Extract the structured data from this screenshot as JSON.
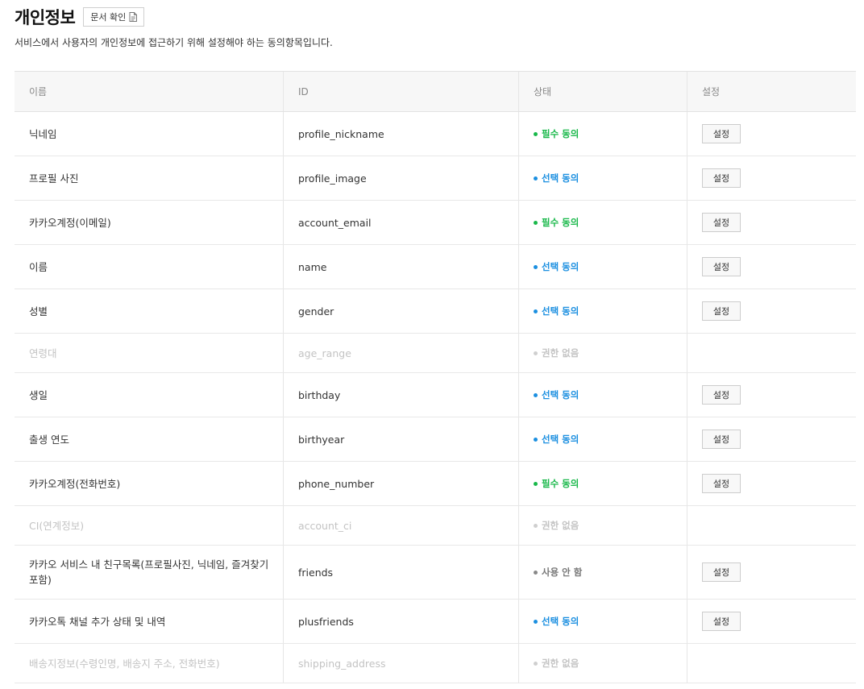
{
  "header": {
    "title": "개인정보",
    "doc_button_label": "문서 확인",
    "description": "서비스에서 사용자의 개인정보에 접근하기 위해 설정해야 하는 동의항목입니다."
  },
  "table": {
    "columns": [
      "이름",
      "ID",
      "상태",
      "설정"
    ],
    "rows": [
      {
        "name": "닉네임",
        "id": "profile_nickname",
        "status": "필수 동의",
        "status_type": "required",
        "button": "설정"
      },
      {
        "name": "프로필 사진",
        "id": "profile_image",
        "status": "선택 동의",
        "status_type": "optional",
        "button": "설정"
      },
      {
        "name": "카카오계정(이메일)",
        "id": "account_email",
        "status": "필수 동의",
        "status_type": "required",
        "button": "설정"
      },
      {
        "name": "이름",
        "id": "name",
        "status": "선택 동의",
        "status_type": "optional",
        "button": "설정"
      },
      {
        "name": "성별",
        "id": "gender",
        "status": "선택 동의",
        "status_type": "optional",
        "button": "설정"
      },
      {
        "name": "연령대",
        "id": "age_range",
        "status": "권한 없음",
        "status_type": "none",
        "button": ""
      },
      {
        "name": "생일",
        "id": "birthday",
        "status": "선택 동의",
        "status_type": "optional",
        "button": "설정"
      },
      {
        "name": "출생 연도",
        "id": "birthyear",
        "status": "선택 동의",
        "status_type": "optional",
        "button": "설정"
      },
      {
        "name": "카카오계정(전화번호)",
        "id": "phone_number",
        "status": "필수 동의",
        "status_type": "required",
        "button": "설정"
      },
      {
        "name": "CI(연계정보)",
        "id": "account_ci",
        "status": "권한 없음",
        "status_type": "none",
        "button": ""
      },
      {
        "name": "카카오 서비스 내 친구목록(프로필사진, 닉네임, 즐겨찾기 포함)",
        "id": "friends",
        "status": "사용 안 함",
        "status_type": "unused",
        "button": "설정"
      },
      {
        "name": "카카오톡 채널 추가 상태 및 내역",
        "id": "plusfriends",
        "status": "선택 동의",
        "status_type": "optional",
        "button": "설정"
      },
      {
        "name": "배송지정보(수령인명, 배송지 주소, 전화번호)",
        "id": "shipping_address",
        "status": "권한 없음",
        "status_type": "none",
        "button": ""
      }
    ]
  },
  "colors": {
    "required": "#19b84a",
    "optional": "#1b8fe0",
    "none": "#c3c3c3",
    "unused": "#777777"
  },
  "icons": {
    "doc_button_icon": "document-icon"
  }
}
